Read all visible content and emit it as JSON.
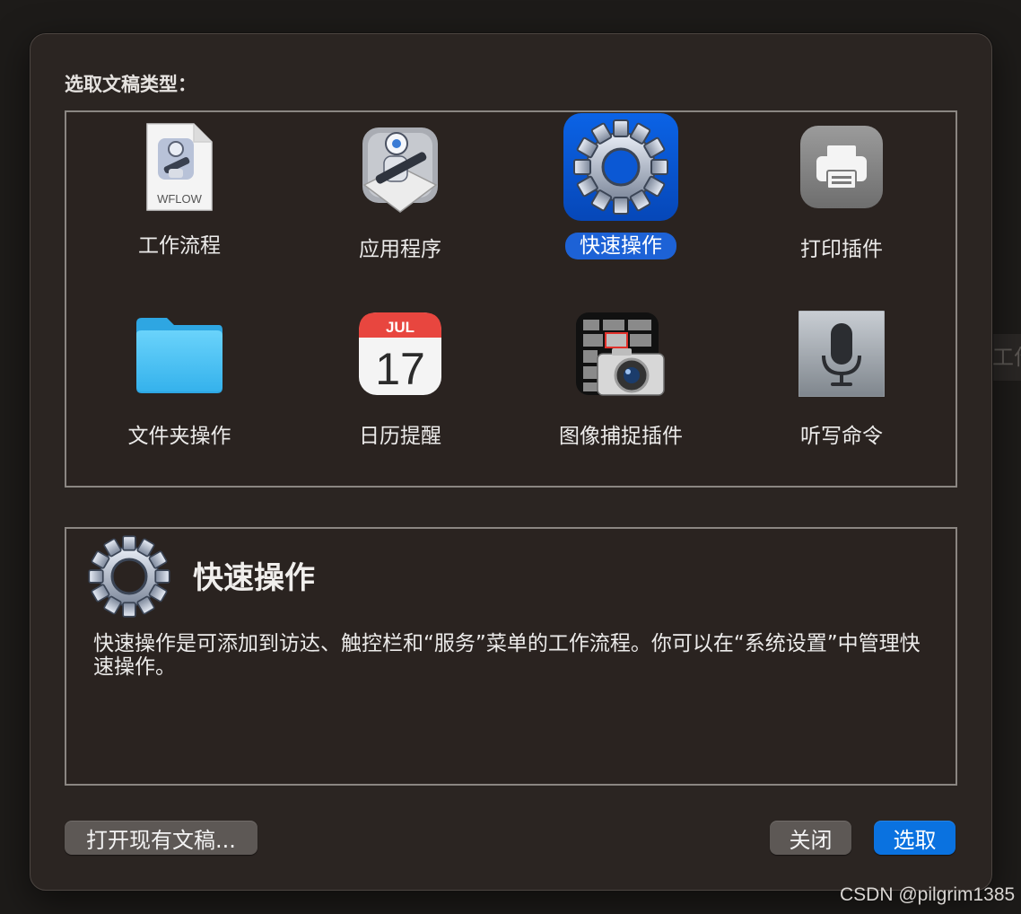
{
  "background_hint": "工作",
  "dialog": {
    "prompt": "选取文稿类型：",
    "types": [
      {
        "label": "工作流程",
        "icon": "workflow-file-icon",
        "file_badge": "WFLOW",
        "selected": false
      },
      {
        "label": "应用程序",
        "icon": "automator-robot-icon",
        "selected": false
      },
      {
        "label": "快速操作",
        "icon": "gear-icon",
        "selected": true
      },
      {
        "label": "打印插件",
        "icon": "printer-icon",
        "selected": false
      },
      {
        "label": "文件夹操作",
        "icon": "folder-icon",
        "selected": false
      },
      {
        "label": "日历提醒",
        "icon": "calendar-icon",
        "month": "JUL",
        "day": "17",
        "selected": false
      },
      {
        "label": "图像捕捉插件",
        "icon": "image-capture-icon",
        "selected": false
      },
      {
        "label": "听写命令",
        "icon": "microphone-icon",
        "selected": false
      }
    ],
    "description": {
      "title": "快速操作",
      "text": "快速操作是可添加到访达、触控栏和“服务”菜单的工作流程。你可以在“系统设置”中管理快速操作。"
    },
    "buttons": {
      "open_existing": "打开现有文稿...",
      "close": "关闭",
      "choose": "选取"
    }
  },
  "colors": {
    "accent": "#0a72e0",
    "selection": "#1d62d6",
    "panel": "#2b2522"
  },
  "watermark": "CSDN @pilgrim1385"
}
